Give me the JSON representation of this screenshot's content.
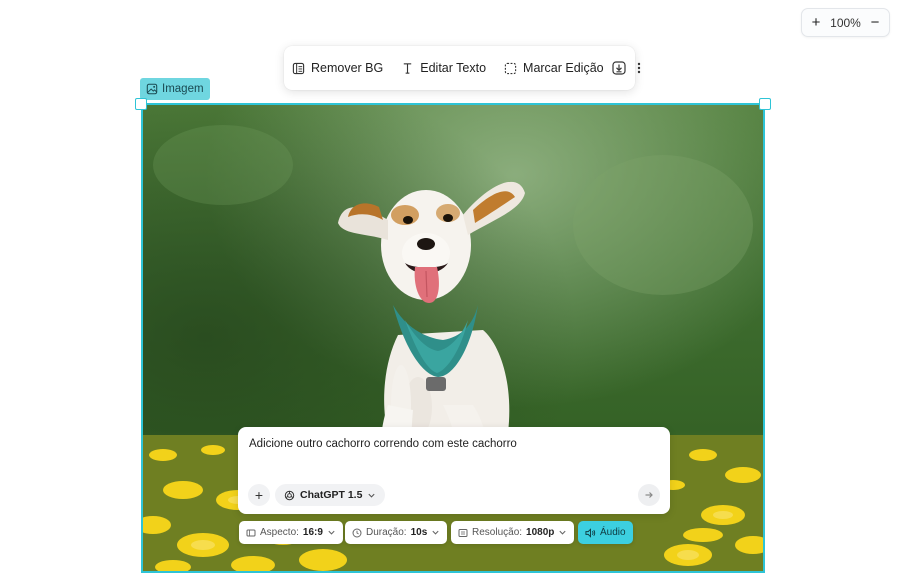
{
  "zoom": {
    "level": "100%",
    "plus_symbol": "+",
    "minus_symbol": "−"
  },
  "toolbar": {
    "remove_bg_label": "Remover BG",
    "edit_text_label": "Editar Texto",
    "mark_edit_label": "Marcar Edição"
  },
  "image_label": "Imagem",
  "prompt": {
    "text": "Adicione outro cachorro correndo com este cachorro",
    "add_symbol": "+",
    "model_label": "ChatGPT 1.5"
  },
  "options": {
    "aspect": {
      "label": "Aspecto:",
      "value": "16:9"
    },
    "duration": {
      "label": "Duração:",
      "value": "10s"
    },
    "resolution": {
      "label": "Resolução:",
      "value": "1080p"
    },
    "audio_label": "Áudio"
  },
  "colors": {
    "accent": "#2ec4d6",
    "label_bg": "#6fd6e0",
    "audio_bg": "#3ccfe0"
  },
  "icons": [
    "plus-icon",
    "minus-icon",
    "remove-bg-icon",
    "text-cursor-icon",
    "dashed-selection-icon",
    "download-icon",
    "more-vertical-icon",
    "image-icon",
    "openai-icon",
    "chevron-down-icon",
    "arrow-right-icon",
    "aspect-icon",
    "clock-icon",
    "resolution-icon",
    "speaker-icon"
  ]
}
